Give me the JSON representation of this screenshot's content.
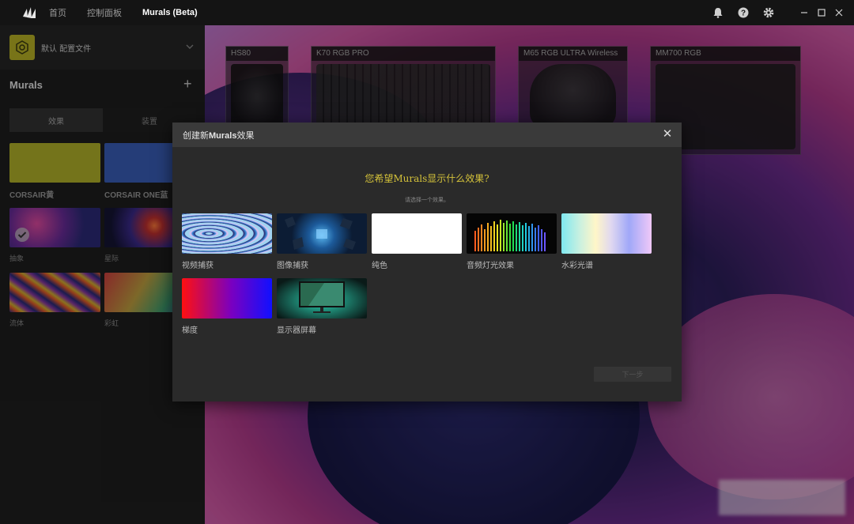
{
  "titlebar": {
    "nav": [
      "首页",
      "控制面板",
      "Murals (Beta)"
    ],
    "logo_icon": "corsair-sails-icon",
    "icons": [
      "bell-icon",
      "help-icon",
      "gear-icon",
      "minimize-icon",
      "maximize-icon",
      "close-icon"
    ]
  },
  "sidebar": {
    "profile_name": "默认 配置文件",
    "murals_title": "Murals",
    "add_symbol": "+",
    "tabs": [
      "效果",
      "装置"
    ],
    "tiles": [
      {
        "label": "CORSAIR黄",
        "color": "#b3b22a"
      },
      {
        "label": "CORSAIR ONE蓝",
        "color": "#3a5fb8"
      },
      {
        "label": "抽象"
      },
      {
        "label": "星际"
      },
      {
        "label": "流体"
      },
      {
        "label": "彩虹"
      }
    ]
  },
  "devices": [
    {
      "name": "HS80"
    },
    {
      "name": "K70 RGB PRO"
    },
    {
      "name": "M65 RGB ULTRA Wireless"
    },
    {
      "name": "MM700 RGB"
    }
  ],
  "modal": {
    "title_prefix": "创建新",
    "title_brand": "Murals",
    "title_suffix": "效果",
    "close_symbol": "✕",
    "question": "您希望Murals显示什么效果?",
    "subtitle": "请选择一个效果。",
    "effects": [
      {
        "label": "视频捕获"
      },
      {
        "label": "图像捕获"
      },
      {
        "label": "纯色"
      },
      {
        "label": "音频灯光效果"
      },
      {
        "label": "水彩光谱"
      },
      {
        "label": "梯度"
      },
      {
        "label": "显示器屏幕"
      }
    ],
    "next_label": "下一步"
  },
  "colors": {
    "accent_yellow": "#d4c23a",
    "modal_bg": "#2a2a2a",
    "header_bg": "#3a3a3a"
  }
}
